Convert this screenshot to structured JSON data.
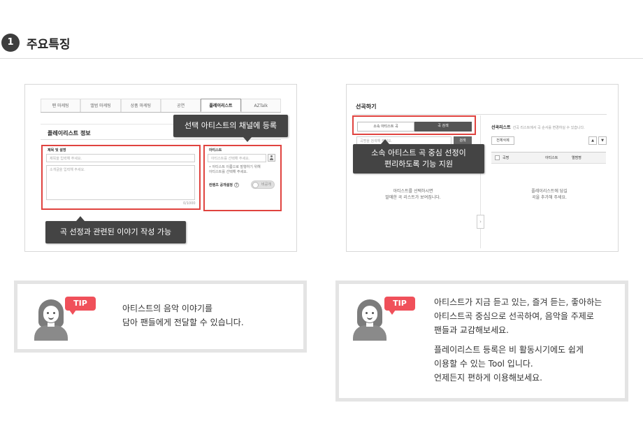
{
  "section": {
    "number": "1",
    "title": "주요특징"
  },
  "left_shot": {
    "tabs": [
      "팬 마케팅",
      "앨범 마케팅",
      "상품 마케팅",
      "공연",
      "플레이리스트",
      "AZTalk"
    ],
    "active_tab_index": 4,
    "panel_title": "플레이리스트 정보",
    "title_label": "제목 및 설명",
    "title_placeholder": "제목을 입력해 주세요.",
    "desc_placeholder": "소개글을 입력해 주세요.",
    "counter": "0/1000",
    "artist_label": "아티스트",
    "artist_placeholder": "아티스트를 선택해 주세요.",
    "artist_note_line1": "• 아티스트 이름으로 발행하기 위해",
    "artist_note_line2": "  아티스트를 선택해 주세요.",
    "public_label": "컨텐츠 공개설정",
    "help_glyph": "?",
    "toggle_label": "비공개"
  },
  "tooltips": {
    "channel": "선택 아티스트의 채널에 등록",
    "story": "곡 선정과 관련된 이야기 작성 가능",
    "select_line1": "소속 아티스트 곡 중심 선정이",
    "select_line2": "편리하도록 기능 지원"
  },
  "right_shot": {
    "title": "선곡하기",
    "tab1": "소속 아티스트 곡",
    "tab2": "곡 검색",
    "search_placeholder": "곡명을 검색해 주세요.",
    "search_button": "검색",
    "list_title": "선곡리스트",
    "list_subtitle": "선곡 리스트에서 곡 순서를 변경하실 수 있습니다.",
    "delete_all": "전체삭제",
    "up_glyph": "▲",
    "down_glyph": "▼",
    "col_song": "곡명",
    "col_artist": "아티스트",
    "col_album": "앨범명",
    "left_empty_line1": "아티스트를 선택하시면",
    "left_empty_line2": "발매한 곡 리스트가 보여집니다.",
    "right_empty_line1": "플레이리스트에 담길",
    "right_empty_line2": "곡을 추가해 주세요.",
    "arrow_glyph": "›"
  },
  "tips": {
    "badge": "TIP",
    "left_line1": "아티스트의 음악 이야기를",
    "left_line2": "담아 팬들에게 전달할 수 있습니다.",
    "right_line1": "아티스트가 지금 듣고 있는, 즐겨 듣는, 좋아하는",
    "right_line2": "아티스트곡 중심으로 선곡하여, 음악을 주제로",
    "right_line3": "팬들과 교감해보세요.",
    "right_line4": "플레이리스트 등록은 비 활동시기에도 쉽게",
    "right_line5": "이용할 수 있는 Tool 입니다.",
    "right_line6": "언제든지 편하게 이용해보세요."
  },
  "colors": {
    "highlight": "#e0433f",
    "tooltip_bg": "#444444",
    "tip_badge": "#f0505a",
    "badge_dark": "#3d3d3d"
  }
}
